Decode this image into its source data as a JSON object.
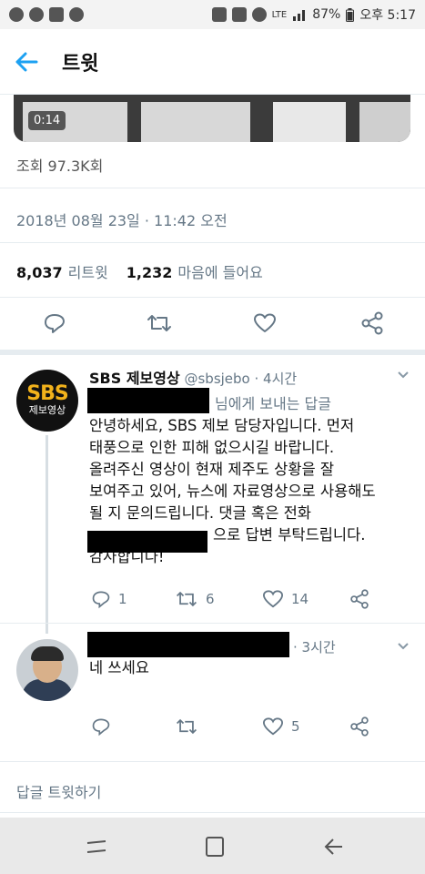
{
  "status_bar": {
    "battery": "87%",
    "time": "오후 5:17",
    "lte": "LTE"
  },
  "header": {
    "title": "트윗"
  },
  "tweet": {
    "video_duration": "0:14",
    "views": "조회 97.3K회",
    "timestamp": "2018년 08월 23일 · 11:42 오전",
    "retweet_count": "8,037",
    "retweet_label": "리트윗",
    "like_count": "1,232",
    "like_label": "마음에 들어요"
  },
  "replies": [
    {
      "avatar_logo": "SBS",
      "avatar_sub": "제보영상",
      "name": "SBS 제보영상",
      "handle": "@sbsjebo",
      "time": "· 4시간",
      "reply_to_suffix": "님에게 보내는 답글",
      "lines": [
        "안녕하세요, SBS 제보 담당자입니다. 먼저",
        "태풍으로 인한 피해 없으시길 바랍니다.",
        "올려주신 영상이 현재 제주도 상황을 잘",
        "보여주고 있어, 뉴스에 자료영상으로 사용해도",
        "될 지 문의드립니다. 댓글 혹은 전화",
        "으로 답변 부탁드립니다.",
        "감사합니다!"
      ],
      "reply_count": "1",
      "retweet_count": "6",
      "like_count": "14"
    },
    {
      "time": "· 3시간",
      "text": "네 쓰세요",
      "like_count": "5"
    }
  ],
  "compose_label": "답글 트윗하기",
  "colors": {
    "accent": "#1da1f2",
    "secondary_text": "#657786",
    "divider": "#e6ecf0",
    "sbs_yellow": "#f2b21b"
  }
}
